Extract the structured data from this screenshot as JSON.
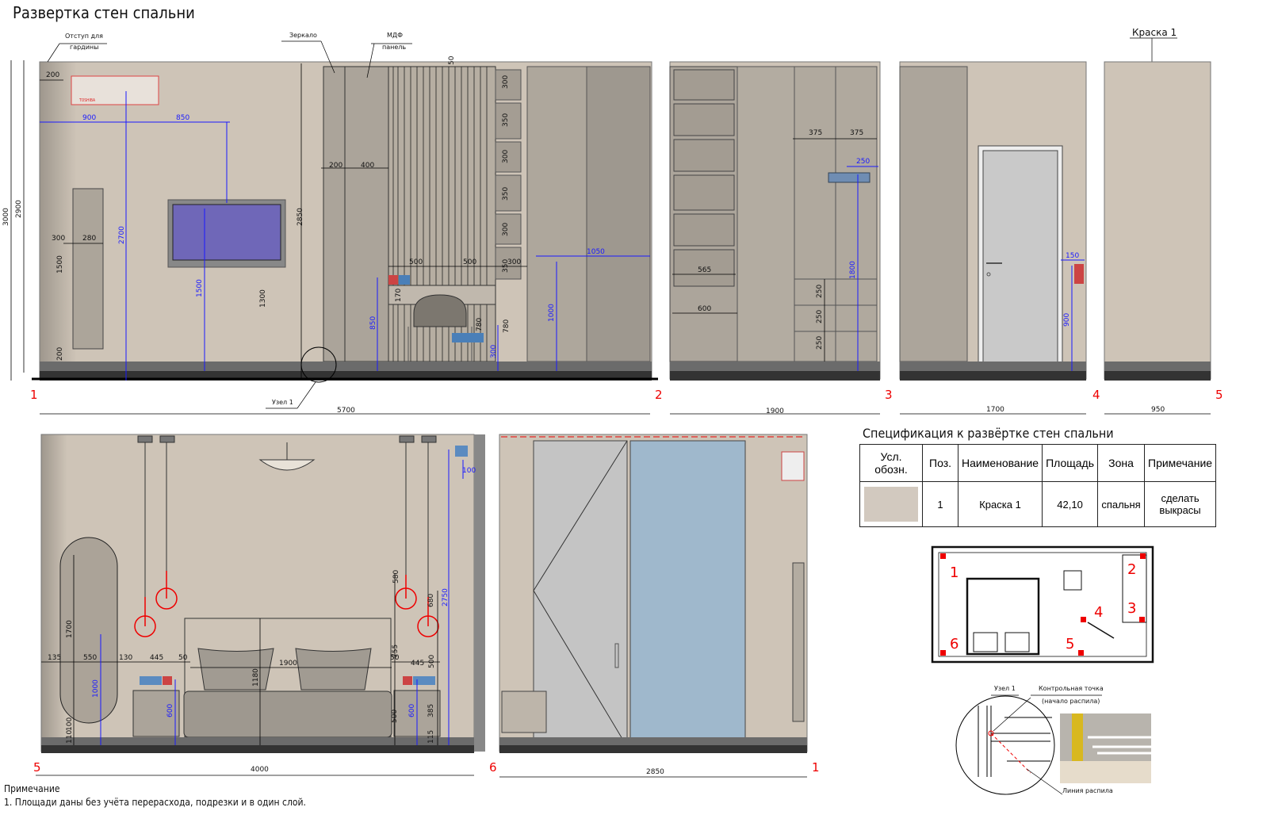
{
  "title": "Развертка стен спальни",
  "callouts": {
    "curtain_line1": "Отступ для",
    "curtain_line2": "гардины",
    "mirror": "Зеркало",
    "mdf_line1": "МДФ",
    "mdf_line2": "панель",
    "paint": "Краска 1",
    "node": "Узел 1",
    "control_line1": "Контрольная точка",
    "control_line2": "(начало распила)",
    "cut_line": "Линия распила"
  },
  "wall_numbers": [
    "1",
    "2",
    "3",
    "4",
    "5",
    "6"
  ],
  "wall_widths": {
    "w1": "5700",
    "w2": "1900",
    "w3": "1700",
    "w4": "950",
    "w5": "4000",
    "w6": "2850"
  },
  "wall1_dims": {
    "h3000": "3000",
    "h2900": "2900",
    "d200": "200",
    "d900": "900",
    "d850": "850",
    "d2700": "2700",
    "d300": "300",
    "d280": "280",
    "d1500a": "1500",
    "d200b": "200",
    "d1500b": "1500",
    "d1300": "1300",
    "d2850": "2850",
    "d200c": "200",
    "d400": "400",
    "d500a": "500",
    "d500b": "500",
    "d300b": "300",
    "d170": "170",
    "d850b": "850",
    "d780a": "780",
    "d780b": "780",
    "d300c": "300",
    "d1050": "1050",
    "d1000": "1000",
    "d50": "50",
    "s1": "300",
    "s2": "350",
    "s3": "300",
    "s4": "350",
    "s5": "300",
    "s6": "350"
  },
  "wall2_dims": {
    "d375a": "375",
    "d375b": "375",
    "d250": "250",
    "d565": "565",
    "d600": "600",
    "d1800": "1800",
    "d250a": "250",
    "d250b": "250",
    "d250c": "250"
  },
  "wall3_dims": {
    "d150": "150",
    "d900": "900"
  },
  "wall5_dims": {
    "d1700": "1700",
    "d135": "135",
    "d550": "550",
    "d130": "130",
    "d445a": "445",
    "d50a": "50",
    "d1900": "1900",
    "d1180": "1180",
    "d50b": "50",
    "d445b": "445",
    "d500a": "500",
    "d755": "755",
    "d580": "580",
    "d680": "680",
    "d2750": "2750",
    "d100a": "100",
    "d1000": "1000",
    "d600a": "600",
    "d600b": "600",
    "d500b": "500",
    "d385": "385",
    "d115": "115",
    "d110": "110",
    "d100b": "100"
  },
  "spec": {
    "title": "Спецификация к развёртке стен спальни",
    "headers": [
      "Усл. обозн.",
      "Поз.",
      "Наименование",
      "Площадь",
      "Зона",
      "Примечание"
    ],
    "row": {
      "pos": "1",
      "name": "Краска 1",
      "area": "42,10",
      "zone": "спальня",
      "note": "сделать выкрасы"
    },
    "swatch_color": "#d2c9bf"
  },
  "notes": {
    "heading": "Примечание",
    "item1": "1. Площади даны без учёта перерасхода, подрезки и в один слой."
  },
  "colors": {
    "wall": "#cec4b7",
    "panel": "#aba49a",
    "dim_blue": "#1a1aff",
    "marker_red": "#e00000",
    "glass": "#9fb8cc"
  }
}
